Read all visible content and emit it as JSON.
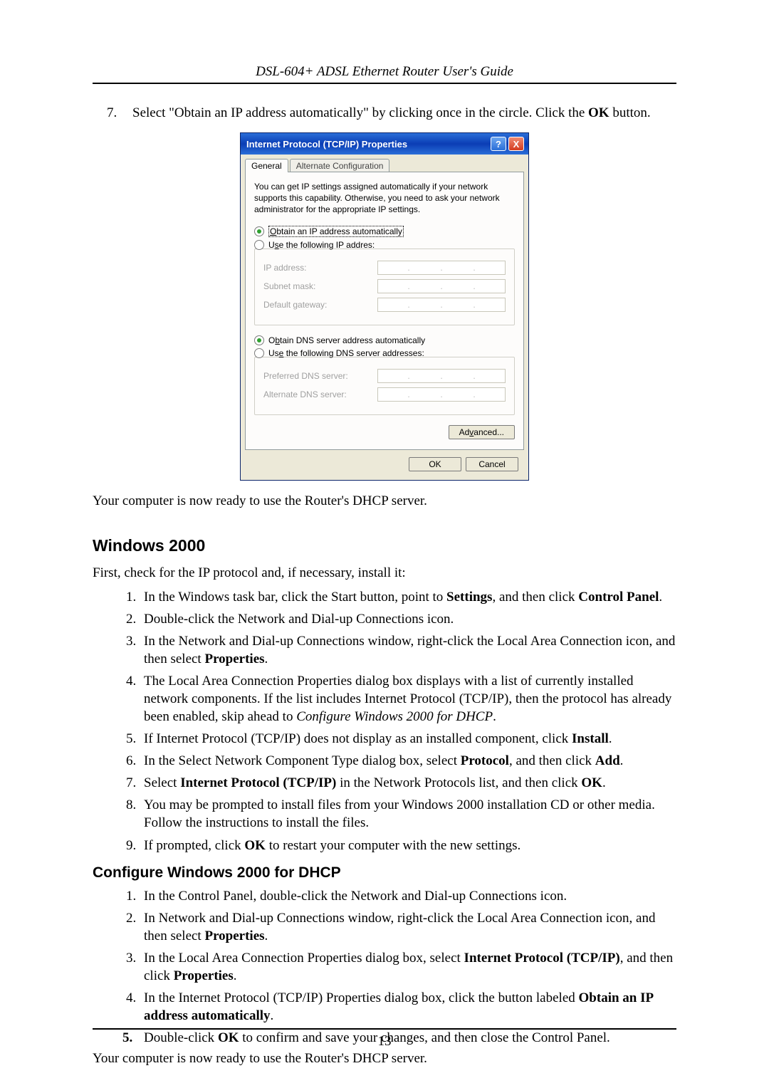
{
  "header": {
    "title": "DSL-604+ ADSL Ethernet Router User's Guide"
  },
  "page_number": "13",
  "intro_item": {
    "num": "7.",
    "text_before": "Select \"Obtain an IP address automatically\" by clicking once in the circle. Click the ",
    "bold1": "OK",
    "text_after": " button."
  },
  "dialog": {
    "title": "Internet Protocol (TCP/IP) Properties",
    "help_glyph": "?",
    "close_glyph": "X",
    "tabs": {
      "general": "General",
      "alt": "Alternate Configuration"
    },
    "desc": "You can get IP settings assigned automatically if your network supports this capability. Otherwise, you need to ask your network administrator for the appropriate IP settings.",
    "radio_ip_auto_pre": "O",
    "radio_ip_auto_label": "btain an IP address automatically",
    "radio_ip_use_pre": "U",
    "radio_ip_use_suf": "s",
    "radio_ip_use_label_a": "e the following IP addres",
    "radio_ip_use_label_b": ":",
    "lbl_ip": "IP address:",
    "lbl_subnet": "Subnet mask:",
    "lbl_gateway": "Default gateway:",
    "radio_dns_auto_pre": "O",
    "radio_dns_auto_u": "b",
    "radio_dns_auto_label": "tain DNS server address automatically",
    "radio_dns_use_pre": "Us",
    "radio_dns_use_u": "e",
    "radio_dns_use_label": " the following DNS server addresses:",
    "lbl_pref_dns": "Preferred DNS server:",
    "lbl_alt_dns": "Alternate DNS server:",
    "btn_adv_pre": "Ad",
    "btn_adv_u": "v",
    "btn_adv_suf": "anced...",
    "btn_ok": "OK",
    "btn_cancel": "Cancel"
  },
  "after_dialog": "Your computer is now ready to use the Router's DHCP server.",
  "h_win2000": "Windows 2000",
  "win2000_intro": "First, check for the IP protocol and, if necessary, install it:",
  "win2000_list": [
    {
      "segments": [
        {
          "t": "In the Windows task bar, click the Start button, point to "
        },
        {
          "t": "Settings",
          "b": true
        },
        {
          "t": ", and then click "
        },
        {
          "t": "Control Panel",
          "b": true
        },
        {
          "t": "."
        }
      ]
    },
    {
      "segments": [
        {
          "t": "Double-click the Network and Dial-up Connections icon."
        }
      ]
    },
    {
      "segments": [
        {
          "t": "In the Network and Dial-up Connections window, right-click the Local Area Connection icon, and then select "
        },
        {
          "t": "Properties",
          "b": true
        },
        {
          "t": "."
        }
      ]
    },
    {
      "segments": [
        {
          "t": "The Local Area Connection Properties dialog box displays with a list of currently installed network components. If the list includes Internet Protocol (TCP/IP), then the protocol has already been enabled, skip ahead to "
        },
        {
          "t": "Configure Windows 2000 for DHCP",
          "i": true
        },
        {
          "t": "."
        }
      ]
    },
    {
      "segments": [
        {
          "t": "If Internet Protocol (TCP/IP) does not display as an installed component, click "
        },
        {
          "t": "Install",
          "b": true
        },
        {
          "t": "."
        }
      ]
    },
    {
      "segments": [
        {
          "t": "In the Select Network Component Type dialog box, select "
        },
        {
          "t": "Protocol",
          "b": true
        },
        {
          "t": ", and then click "
        },
        {
          "t": "Add",
          "b": true
        },
        {
          "t": "."
        }
      ]
    },
    {
      "segments": [
        {
          "t": "Select "
        },
        {
          "t": "Internet Protocol (TCP/IP)",
          "b": true
        },
        {
          "t": " in the Network Protocols list, and then click "
        },
        {
          "t": "OK",
          "b": true
        },
        {
          "t": "."
        }
      ]
    },
    {
      "segments": [
        {
          "t": "You may be prompted to install files from your Windows 2000 installation CD or other media. Follow the instructions to install the files."
        }
      ]
    },
    {
      "segments": [
        {
          "t": "If prompted, click "
        },
        {
          "t": "OK",
          "b": true
        },
        {
          "t": " to restart your computer with the new settings."
        }
      ]
    }
  ],
  "h_cfg2000": "Configure Windows 2000 for DHCP",
  "cfg2000_list": [
    {
      "segments": [
        {
          "t": "In the Control Panel, double-click the Network and Dial-up Connections icon."
        }
      ]
    },
    {
      "segments": [
        {
          "t": "In Network and Dial-up Connections window, right-click the Local Area Connection icon, and then select "
        },
        {
          "t": "Properties",
          "b": true
        },
        {
          "t": "."
        }
      ]
    },
    {
      "segments": [
        {
          "t": "In the Local Area Connection Properties dialog box, select "
        },
        {
          "t": "Internet Protocol (TCP/IP)",
          "b": true
        },
        {
          "t": ", and then click "
        },
        {
          "t": "Properties",
          "b": true
        },
        {
          "t": "."
        }
      ]
    },
    {
      "segments": [
        {
          "t": "In the Internet Protocol (TCP/IP) Properties dialog box, click the button labeled "
        },
        {
          "t": "Obtain an IP address automatically",
          "b": true
        },
        {
          "t": "."
        }
      ]
    },
    {
      "num_bold": true,
      "segments": [
        {
          "t": "Double-click "
        },
        {
          "t": "OK",
          "b": true
        },
        {
          "t": " to confirm and save your changes, and then close the Control Panel."
        }
      ]
    }
  ],
  "closing": "Your computer is now ready to use the Router's DHCP server."
}
